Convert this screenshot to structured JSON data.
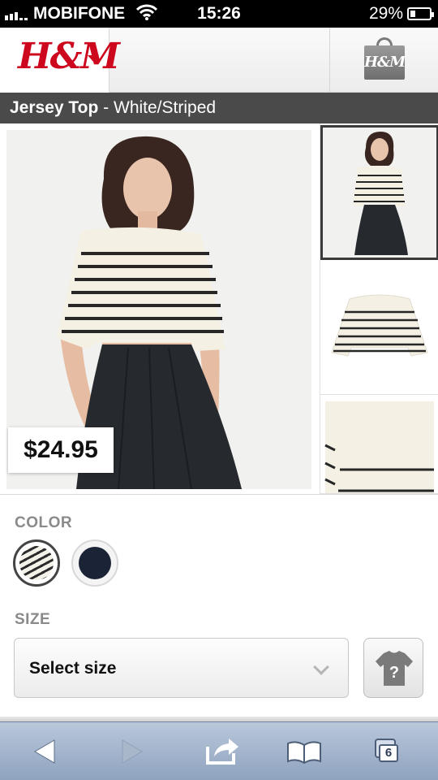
{
  "status_bar": {
    "carrier": "MOBIFONE",
    "time": "15:26",
    "battery": "29%",
    "battery_level": 0.29
  },
  "header": {
    "logo_text": "H&M",
    "bag_text": "H&M"
  },
  "product": {
    "name": "Jersey Top",
    "separator": " - ",
    "variant": "White/Striped",
    "price": "$24.95"
  },
  "color_section": {
    "label": "COLOR",
    "swatches": [
      {
        "name": "striped",
        "selected": true
      },
      {
        "name": "dark-blue",
        "selected": false
      }
    ]
  },
  "size_section": {
    "label": "SIZE",
    "select_value": "Select size"
  },
  "toolbar": {
    "tabs_count": "6"
  },
  "icons": [
    "wifi-icon",
    "battery-icon",
    "logo-menu-caret-icon",
    "shopping-bag-icon",
    "chevron-down-icon",
    "size-guide-icon",
    "back-icon",
    "forward-icon",
    "share-icon",
    "bookmarks-icon",
    "tabs-icon"
  ],
  "colors": {
    "brand_red": "#cc071e",
    "title_bar": "#4a4a4a",
    "toolbar_top": "#b9c7da",
    "toolbar_bottom": "#8fa3bf"
  }
}
